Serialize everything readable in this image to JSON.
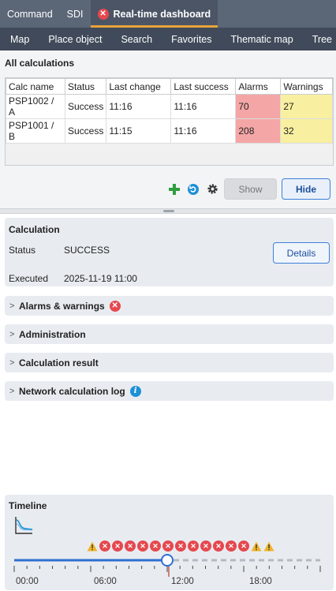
{
  "tabs": [
    {
      "label": "Command",
      "active": false
    },
    {
      "label": "SDI",
      "active": false
    },
    {
      "label": "Real-time dashboard",
      "active": true,
      "icon": "close-circle-icon"
    }
  ],
  "nav": [
    "Map",
    "Place object",
    "Search",
    "Favorites",
    "Thematic map",
    "Tree"
  ],
  "calculations": {
    "title": "All calculations",
    "columns": [
      "Calc name",
      "Status",
      "Last change",
      "Last success",
      "Alarms",
      "Warnings"
    ],
    "rows": [
      [
        "PSP1002 / A",
        "Success",
        "11:16",
        "11:16",
        "70",
        "27"
      ],
      [
        "PSP1001 / B",
        "Success",
        "11:15",
        "11:16",
        "208",
        "32"
      ]
    ],
    "colors": {
      "alarm": "#f4a6a6",
      "warning": "#f8f0a0"
    }
  },
  "actions": {
    "show_label": "Show",
    "hide_label": "Hide",
    "icons": [
      "plus-icon",
      "refresh-icon",
      "gear-icon"
    ]
  },
  "calculation": {
    "title": "Calculation",
    "status_label": "Status",
    "status_value": "SUCCESS",
    "executed_label": "Executed",
    "executed_value": "2025-11-19 11:00",
    "details_label": "Details"
  },
  "sections": [
    {
      "label": "Alarms & warnings",
      "badge": "error"
    },
    {
      "label": "Administration",
      "badge": ""
    },
    {
      "label": "Calculation result",
      "badge": ""
    },
    {
      "label": "Network calculation log",
      "badge": "info"
    }
  ],
  "timeline": {
    "title": "Timeline",
    "ticks": [
      "00:00",
      "06:00",
      "12:00",
      "18:00"
    ],
    "markers": [
      "warning",
      "error",
      "error",
      "error",
      "error",
      "error",
      "error",
      "error",
      "error",
      "error",
      "error",
      "error",
      "error",
      "warning",
      "warning"
    ],
    "current_fraction": 0.5
  }
}
